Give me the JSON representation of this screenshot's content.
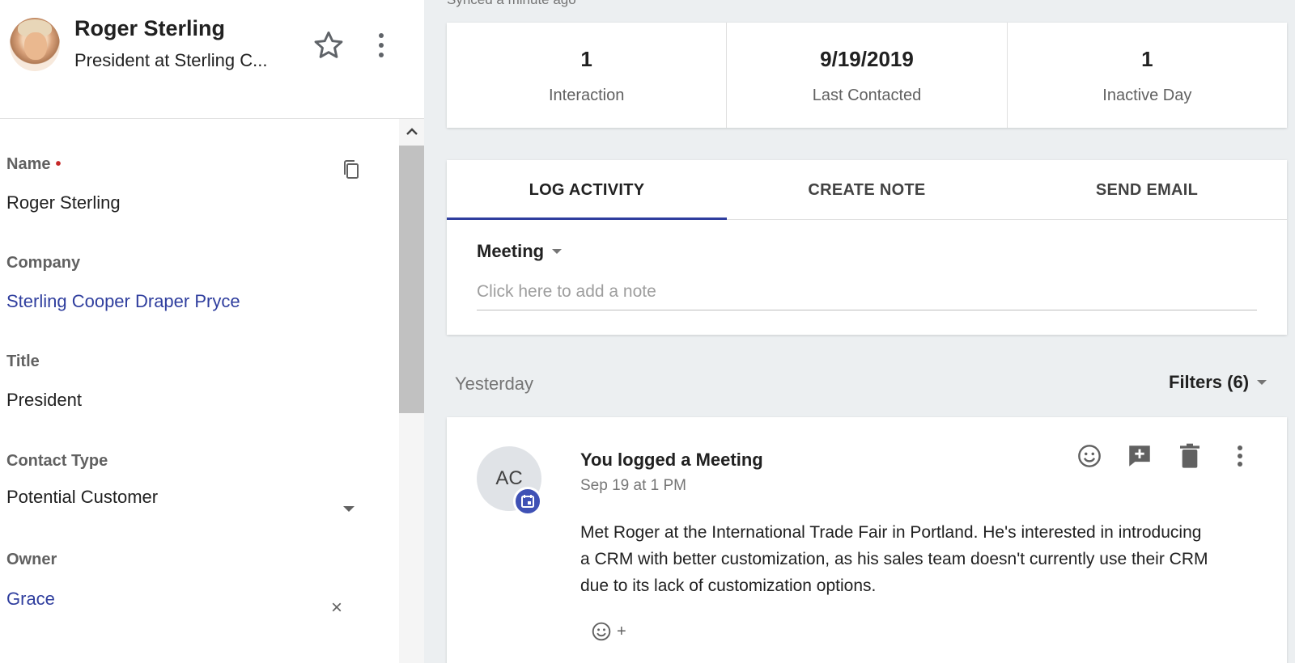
{
  "contact": {
    "name": "Roger Sterling",
    "subtitle": "President at Sterling C..."
  },
  "fields": {
    "name_label": "Name",
    "name_required": "•",
    "name_value": "Roger Sterling",
    "company_label": "Company",
    "company_value": "Sterling Cooper Draper Pryce",
    "title_label": "Title",
    "title_value": "President",
    "contact_type_label": "Contact Type",
    "contact_type_value": "Potential Customer",
    "owner_label": "Owner",
    "owner_value": "Grace",
    "clear_symbol": "×"
  },
  "synced_text": "Synced a minute ago",
  "stats": [
    {
      "value": "1",
      "label": "Interaction"
    },
    {
      "value": "9/19/2019",
      "label": "Last Contacted"
    },
    {
      "value": "1",
      "label": "Inactive Day"
    }
  ],
  "tabs": [
    {
      "label": "LOG ACTIVITY",
      "active": true
    },
    {
      "label": "CREATE NOTE",
      "active": false
    },
    {
      "label": "SEND EMAIL",
      "active": false
    }
  ],
  "activity": {
    "type": "Meeting",
    "note_placeholder": "Click here to add a note"
  },
  "feed": {
    "day_label": "Yesterday",
    "filters_label": "Filters (6)",
    "avatar_initials": "AC",
    "title": "You logged a Meeting",
    "time": "Sep 19 at 1 PM",
    "body": "Met Roger at the International Trade Fair in Portland. He's interested in introducing a CRM with better customization, as his sales team doesn't currently use their CRM due to its lack of customization options.",
    "add_reaction_plus": "+"
  },
  "colors": {
    "accent": "#2f3e9e",
    "badge": "#3f51b5",
    "required": "#c62828"
  }
}
